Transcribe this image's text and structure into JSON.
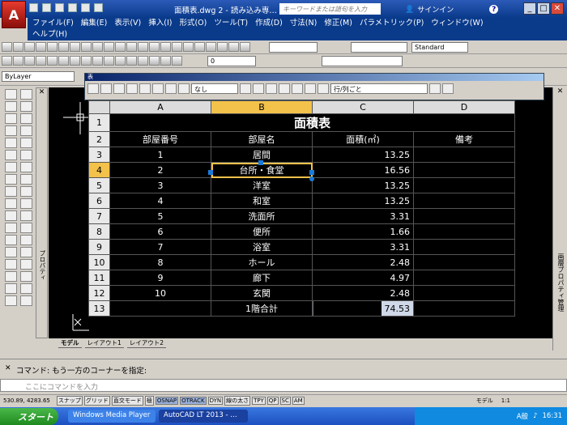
{
  "app": {
    "logo_letter": "A",
    "window_title": "面積表.dwg 2 - 読み込み専…",
    "search_placeholder": "キーワードまたは語句を入力",
    "sign_in": "サインイン",
    "help_label": "?"
  },
  "menu": {
    "items": [
      "ファイル(F)",
      "編集(E)",
      "表示(V)",
      "挿入(I)",
      "形式(O)",
      "ツール(T)",
      "作成(D)",
      "寸法(N)",
      "修正(M)",
      "パラメトリック(P)",
      "ウィンドウ(W)"
    ],
    "help": "ヘルプ(H)"
  },
  "toolbars": {
    "text_style": "Standard",
    "layer_value": "0",
    "bylayer": "ByLayer"
  },
  "table_toolbar": {
    "title": "表",
    "border_combo": "なし",
    "row_col_combo": "行/列ごと"
  },
  "sheet": {
    "columns": [
      "A",
      "B",
      "C",
      "D"
    ],
    "row_numbers": [
      "1",
      "2",
      "3",
      "4",
      "5",
      "6",
      "7",
      "8",
      "9",
      "10",
      "11",
      "12",
      "13"
    ],
    "title": "面積表",
    "header": [
      "部屋番号",
      "部屋名",
      "面積(㎡)",
      "備考"
    ],
    "rows": [
      [
        "1",
        "居間",
        "13.25",
        ""
      ],
      [
        "2",
        "台所・食堂",
        "16.56",
        ""
      ],
      [
        "3",
        "洋室",
        "13.25",
        ""
      ],
      [
        "4",
        "和室",
        "13.25",
        ""
      ],
      [
        "5",
        "洗面所",
        "3.31",
        ""
      ],
      [
        "6",
        "便所",
        "1.66",
        ""
      ],
      [
        "7",
        "浴室",
        "3.31",
        ""
      ],
      [
        "8",
        "ホール",
        "2.48",
        ""
      ],
      [
        "9",
        "廊下",
        "4.97",
        ""
      ],
      [
        "10",
        "玄関",
        "2.48",
        ""
      ]
    ],
    "total": [
      "",
      "1階合計",
      "74.53",
      ""
    ]
  },
  "layout_tabs": [
    "モデル",
    "レイアウト1",
    "レイアウト2"
  ],
  "left_panel_label": "プロパティ",
  "right_palette_label": "画層プロパティ管理",
  "command": {
    "history": "コマンド: もう一方のコーナーを指定:",
    "prompt_placeholder": "ここにコマンドを入力"
  },
  "status": {
    "coords": "530.89, 4283.65",
    "toggles": [
      {
        "label": "スナップ",
        "on": false
      },
      {
        "label": "グリッド",
        "on": false
      },
      {
        "label": "直交モード",
        "on": false
      },
      {
        "label": "極",
        "on": false
      },
      {
        "label": "OSNAP",
        "on": true
      },
      {
        "label": "OTRACK",
        "on": true
      },
      {
        "label": "DYN",
        "on": false
      },
      {
        "label": "線の太さ",
        "on": false
      },
      {
        "label": "TPY",
        "on": false
      },
      {
        "label": "QP",
        "on": false
      },
      {
        "label": "SC",
        "on": false
      },
      {
        "label": "AM",
        "on": false
      }
    ],
    "model": "モデル",
    "scale": "1:1"
  },
  "taskbar": {
    "start": "スタート",
    "tasks": [
      "Windows Media Player",
      "AutoCAD LT 2013 - …"
    ],
    "ime": "A般",
    "time": "16:31"
  },
  "colors": {
    "title_blue": "#0a3a8a",
    "selection": "#f3c24a",
    "grip": "#1a7ad8",
    "canvas": "#000000",
    "start_green": "#2e9a2e"
  }
}
